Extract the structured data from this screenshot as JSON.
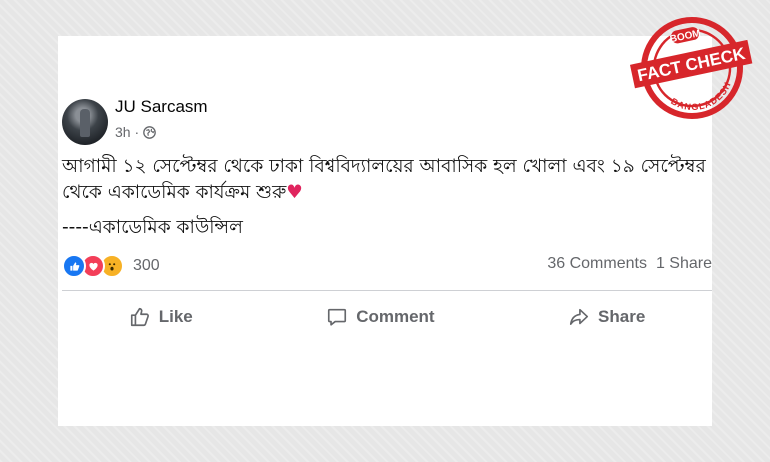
{
  "post": {
    "author": "JU Sarcasm",
    "time": "3h ·",
    "text_line1": "আগামী ১২ সেপ্টেম্বর থেকে ঢাকা বিশ্ববিদ্যালয়ের আবাসিক হল খোলা এবং ১৯ সেপ্টেম্বর",
    "text_line2": "থেকে একাডেমিক কার্যক্রম শুরু",
    "text_emoji": "♥",
    "signature": "----একাডেমিক কাউন্সিল"
  },
  "stats": {
    "reactions": "300",
    "comments": "36 Comments",
    "shares": "1 Share"
  },
  "actions": {
    "like": "Like",
    "comment": "Comment",
    "share": "Share"
  },
  "stamp": {
    "brand": "BOOM",
    "label": "FACT CHECK",
    "country": "BANGLADESH",
    "color": "#d7262b"
  },
  "icons": [
    "globe-icon",
    "like-reaction-icon",
    "love-reaction-icon",
    "wow-reaction-icon",
    "thumbs-up-icon",
    "comment-icon",
    "share-icon"
  ]
}
